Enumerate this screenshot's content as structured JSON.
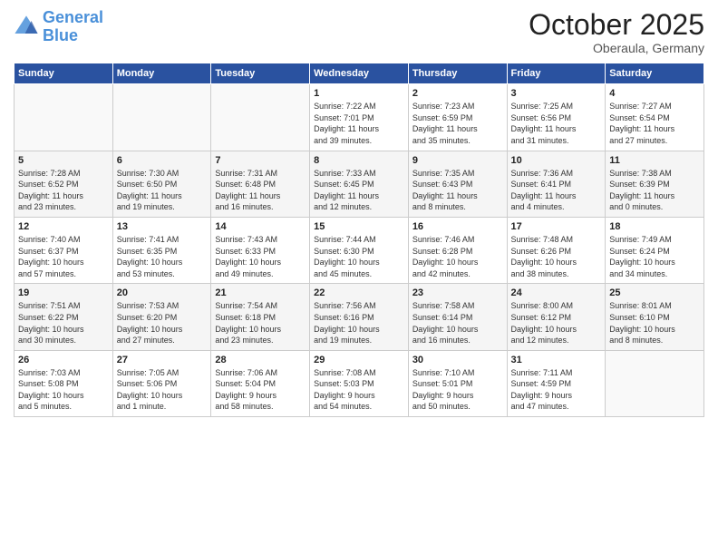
{
  "header": {
    "logo_line1": "General",
    "logo_line2": "Blue",
    "month": "October 2025",
    "location": "Oberaula, Germany"
  },
  "weekdays": [
    "Sunday",
    "Monday",
    "Tuesday",
    "Wednesday",
    "Thursday",
    "Friday",
    "Saturday"
  ],
  "weeks": [
    [
      {
        "day": "",
        "info": ""
      },
      {
        "day": "",
        "info": ""
      },
      {
        "day": "",
        "info": ""
      },
      {
        "day": "1",
        "info": "Sunrise: 7:22 AM\nSunset: 7:01 PM\nDaylight: 11 hours\nand 39 minutes."
      },
      {
        "day": "2",
        "info": "Sunrise: 7:23 AM\nSunset: 6:59 PM\nDaylight: 11 hours\nand 35 minutes."
      },
      {
        "day": "3",
        "info": "Sunrise: 7:25 AM\nSunset: 6:56 PM\nDaylight: 11 hours\nand 31 minutes."
      },
      {
        "day": "4",
        "info": "Sunrise: 7:27 AM\nSunset: 6:54 PM\nDaylight: 11 hours\nand 27 minutes."
      }
    ],
    [
      {
        "day": "5",
        "info": "Sunrise: 7:28 AM\nSunset: 6:52 PM\nDaylight: 11 hours\nand 23 minutes."
      },
      {
        "day": "6",
        "info": "Sunrise: 7:30 AM\nSunset: 6:50 PM\nDaylight: 11 hours\nand 19 minutes."
      },
      {
        "day": "7",
        "info": "Sunrise: 7:31 AM\nSunset: 6:48 PM\nDaylight: 11 hours\nand 16 minutes."
      },
      {
        "day": "8",
        "info": "Sunrise: 7:33 AM\nSunset: 6:45 PM\nDaylight: 11 hours\nand 12 minutes."
      },
      {
        "day": "9",
        "info": "Sunrise: 7:35 AM\nSunset: 6:43 PM\nDaylight: 11 hours\nand 8 minutes."
      },
      {
        "day": "10",
        "info": "Sunrise: 7:36 AM\nSunset: 6:41 PM\nDaylight: 11 hours\nand 4 minutes."
      },
      {
        "day": "11",
        "info": "Sunrise: 7:38 AM\nSunset: 6:39 PM\nDaylight: 11 hours\nand 0 minutes."
      }
    ],
    [
      {
        "day": "12",
        "info": "Sunrise: 7:40 AM\nSunset: 6:37 PM\nDaylight: 10 hours\nand 57 minutes."
      },
      {
        "day": "13",
        "info": "Sunrise: 7:41 AM\nSunset: 6:35 PM\nDaylight: 10 hours\nand 53 minutes."
      },
      {
        "day": "14",
        "info": "Sunrise: 7:43 AM\nSunset: 6:33 PM\nDaylight: 10 hours\nand 49 minutes."
      },
      {
        "day": "15",
        "info": "Sunrise: 7:44 AM\nSunset: 6:30 PM\nDaylight: 10 hours\nand 45 minutes."
      },
      {
        "day": "16",
        "info": "Sunrise: 7:46 AM\nSunset: 6:28 PM\nDaylight: 10 hours\nand 42 minutes."
      },
      {
        "day": "17",
        "info": "Sunrise: 7:48 AM\nSunset: 6:26 PM\nDaylight: 10 hours\nand 38 minutes."
      },
      {
        "day": "18",
        "info": "Sunrise: 7:49 AM\nSunset: 6:24 PM\nDaylight: 10 hours\nand 34 minutes."
      }
    ],
    [
      {
        "day": "19",
        "info": "Sunrise: 7:51 AM\nSunset: 6:22 PM\nDaylight: 10 hours\nand 30 minutes."
      },
      {
        "day": "20",
        "info": "Sunrise: 7:53 AM\nSunset: 6:20 PM\nDaylight: 10 hours\nand 27 minutes."
      },
      {
        "day": "21",
        "info": "Sunrise: 7:54 AM\nSunset: 6:18 PM\nDaylight: 10 hours\nand 23 minutes."
      },
      {
        "day": "22",
        "info": "Sunrise: 7:56 AM\nSunset: 6:16 PM\nDaylight: 10 hours\nand 19 minutes."
      },
      {
        "day": "23",
        "info": "Sunrise: 7:58 AM\nSunset: 6:14 PM\nDaylight: 10 hours\nand 16 minutes."
      },
      {
        "day": "24",
        "info": "Sunrise: 8:00 AM\nSunset: 6:12 PM\nDaylight: 10 hours\nand 12 minutes."
      },
      {
        "day": "25",
        "info": "Sunrise: 8:01 AM\nSunset: 6:10 PM\nDaylight: 10 hours\nand 8 minutes."
      }
    ],
    [
      {
        "day": "26",
        "info": "Sunrise: 7:03 AM\nSunset: 5:08 PM\nDaylight: 10 hours\nand 5 minutes."
      },
      {
        "day": "27",
        "info": "Sunrise: 7:05 AM\nSunset: 5:06 PM\nDaylight: 10 hours\nand 1 minute."
      },
      {
        "day": "28",
        "info": "Sunrise: 7:06 AM\nSunset: 5:04 PM\nDaylight: 9 hours\nand 58 minutes."
      },
      {
        "day": "29",
        "info": "Sunrise: 7:08 AM\nSunset: 5:03 PM\nDaylight: 9 hours\nand 54 minutes."
      },
      {
        "day": "30",
        "info": "Sunrise: 7:10 AM\nSunset: 5:01 PM\nDaylight: 9 hours\nand 50 minutes."
      },
      {
        "day": "31",
        "info": "Sunrise: 7:11 AM\nSunset: 4:59 PM\nDaylight: 9 hours\nand 47 minutes."
      },
      {
        "day": "",
        "info": ""
      }
    ]
  ]
}
